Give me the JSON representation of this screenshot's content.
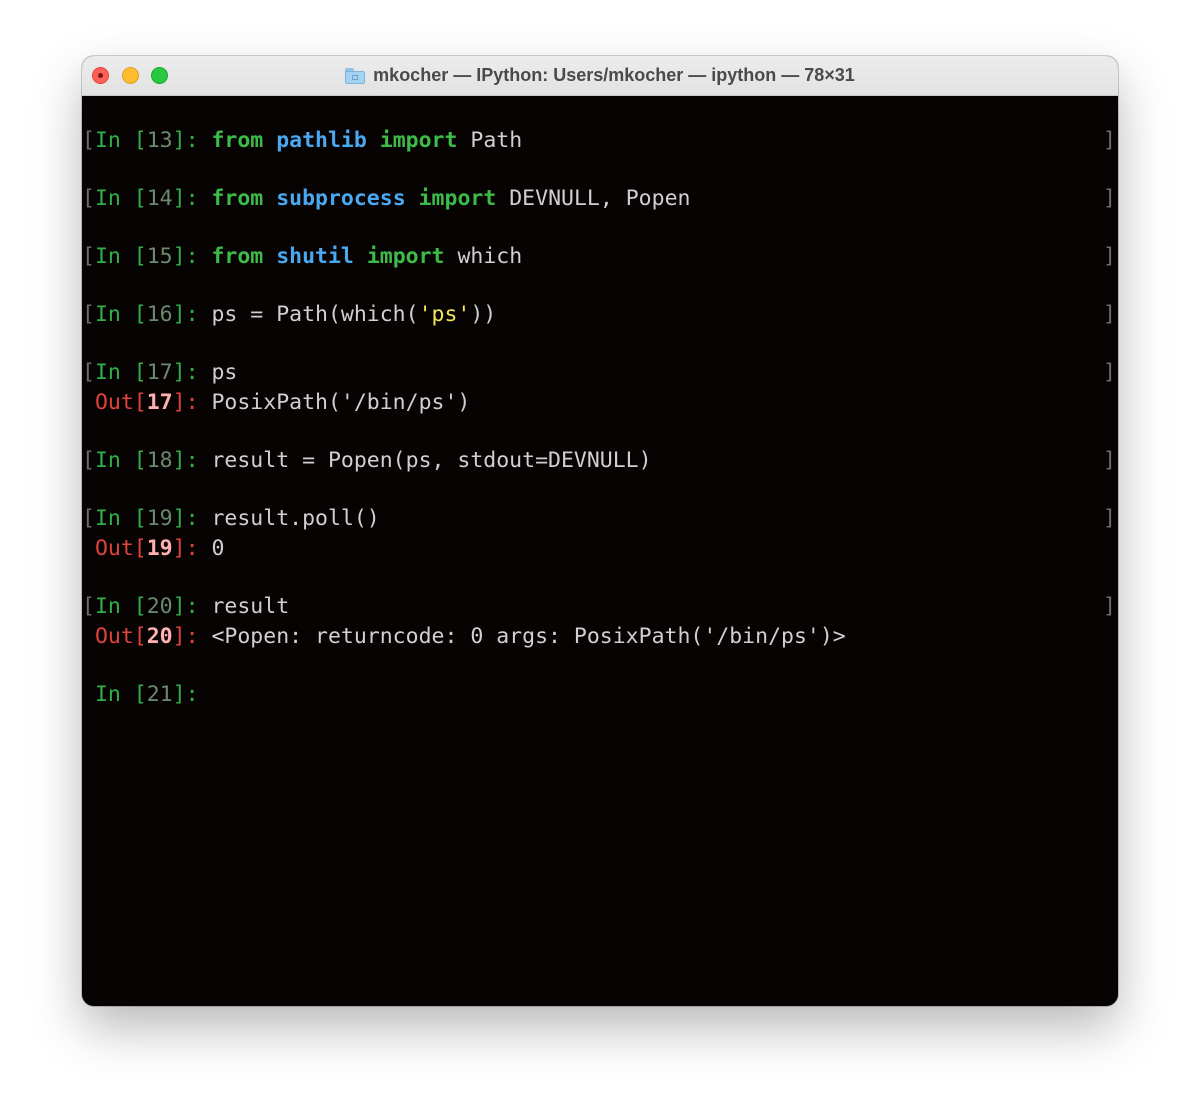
{
  "window": {
    "title": "mkocher — IPython: Users/mkocher — ipython — 78×31",
    "title_icon": "home-folder-icon"
  },
  "terminal": {
    "cells": [
      {
        "in_prefix": "In [",
        "in_num": "13",
        "in_suffix": "]: ",
        "kw1": "from",
        "mod": "pathlib",
        "kw2": "import",
        "rest": "Path"
      },
      {
        "in_prefix": "In [",
        "in_num": "14",
        "in_suffix": "]: ",
        "kw1": "from",
        "mod": "subprocess",
        "kw2": "import",
        "rest": "DEVNULL, Popen"
      },
      {
        "in_prefix": "In [",
        "in_num": "15",
        "in_suffix": "]: ",
        "kw1": "from",
        "mod": "shutil",
        "kw2": "import",
        "rest": "which"
      },
      {
        "in_prefix": "In [",
        "in_num": "16",
        "in_suffix": "]: ",
        "code_a": "ps = Path(which(",
        "str": "'ps'",
        "code_b": "))"
      },
      {
        "in_prefix": "In [",
        "in_num": "17",
        "in_suffix": "]: ",
        "code": "ps",
        "out_prefix": "Out[",
        "out_num": "17",
        "out_suffix": "]: ",
        "out": "PosixPath('/bin/ps')"
      },
      {
        "in_prefix": "In [",
        "in_num": "18",
        "in_suffix": "]: ",
        "code": "result = Popen(ps, stdout=DEVNULL)"
      },
      {
        "in_prefix": "In [",
        "in_num": "19",
        "in_suffix": "]: ",
        "code": "result.poll()",
        "out_prefix": "Out[",
        "out_num": "19",
        "out_suffix": "]: ",
        "out": "0"
      },
      {
        "in_prefix": "In [",
        "in_num": "20",
        "in_suffix": "]: ",
        "code": "result",
        "out_prefix": "Out[",
        "out_num": "20",
        "out_suffix": "]: ",
        "out": "<Popen: returncode: 0 args: PosixPath('/bin/ps')>"
      },
      {
        "in_prefix": "In [",
        "in_num": "21",
        "in_suffix": "]: "
      }
    ],
    "left_bracket": "[",
    "right_bracket": "]"
  },
  "colors": {
    "terminal_bg": "#070302",
    "prompt_in": "#2fb14a",
    "prompt_out": "#e0423c",
    "keyword": "#3dbb49",
    "module": "#4aa8f0",
    "string": "#f4e85a"
  }
}
